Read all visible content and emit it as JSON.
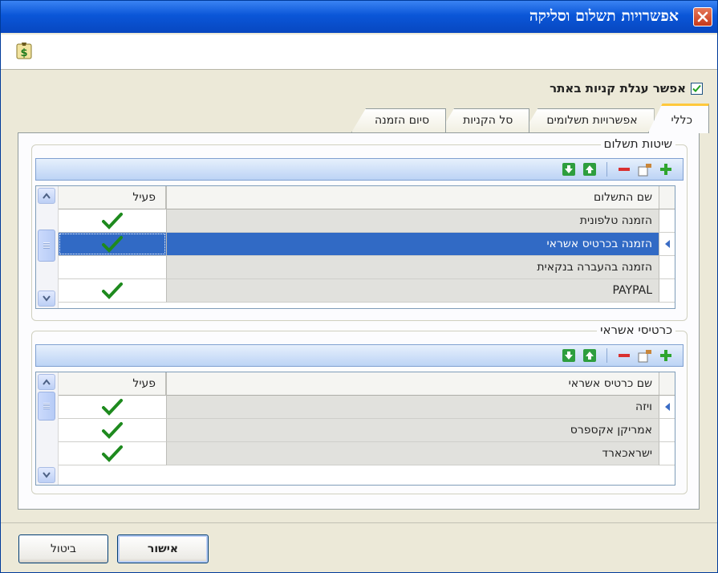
{
  "window": {
    "title": "אפשרויות תשלום וסליקה"
  },
  "shop": {
    "enable_label": "אפשר עגלת קניות באתר",
    "enabled": true
  },
  "tabs": [
    {
      "label": "כללי",
      "active": true
    },
    {
      "label": "אפשרויות תשלומים",
      "active": false
    },
    {
      "label": "סל הקניות",
      "active": false
    },
    {
      "label": "סיום הזמנה",
      "active": false
    }
  ],
  "payment_methods": {
    "legend": "שיטות תשלום",
    "columns": {
      "name": "שם התשלום",
      "active": "פעיל"
    },
    "rows": [
      {
        "name": "הזמנה טלפונית",
        "active": true,
        "selected": false
      },
      {
        "name": "הזמנה בכרטיס אשראי",
        "active": true,
        "selected": true
      },
      {
        "name": "הזמנה בהעברה בנקאית",
        "active": false,
        "selected": false
      },
      {
        "name": "PAYPAL",
        "active": true,
        "selected": false
      }
    ]
  },
  "credit_cards": {
    "legend": "כרטיסי אשראי",
    "columns": {
      "name": "שם כרטיס אשראי",
      "active": "פעיל"
    },
    "rows": [
      {
        "name": "ויזה",
        "active": true,
        "selected": true
      },
      {
        "name": "אמריקן אקספרס",
        "active": true,
        "selected": false
      },
      {
        "name": "ישראכארד",
        "active": true,
        "selected": false
      }
    ]
  },
  "buttons": {
    "ok": "אישור",
    "cancel": "ביטול"
  },
  "colors": {
    "titlebar": "#0A56D8",
    "selection": "#316AC5",
    "check": "#1E8A1E",
    "window_bg": "#ECE9D8"
  }
}
